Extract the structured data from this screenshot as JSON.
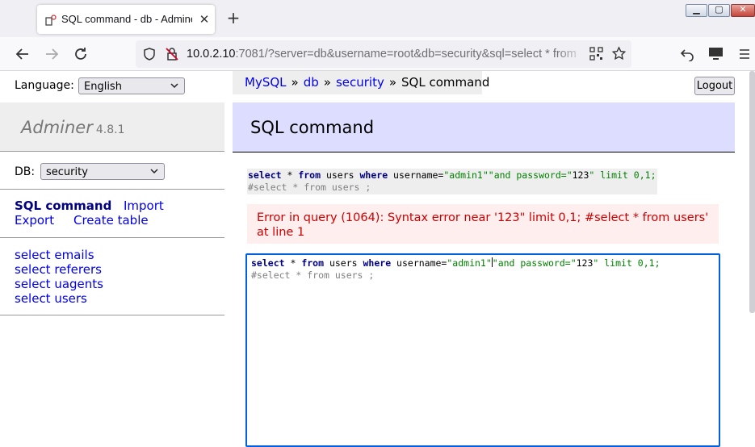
{
  "browser": {
    "tab_title": "SQL command - db - Adminer",
    "url_host": "10.0.2.10",
    "url_rest": ":7081/?server=db&username=root&db=security&sql=select * from"
  },
  "sidebar": {
    "language_label": "Language:",
    "language_value": "English",
    "logo": "Adminer",
    "version": "4.8.1",
    "db_label": "DB:",
    "db_value": "security",
    "links": {
      "sql_command": "SQL command",
      "import": "Import",
      "export": "Export",
      "create_table": "Create table"
    },
    "tables": [
      "select emails",
      "select referers",
      "select uagents",
      "select users"
    ]
  },
  "breadcrumb": {
    "items": [
      "MySQL",
      "db",
      "security"
    ],
    "separator": "»",
    "current": "SQL command"
  },
  "logout_label": "Logout",
  "title": "SQL command",
  "sql": {
    "line1": {
      "kw_select": "select",
      "star": " * ",
      "kw_from": "from",
      "table": " users ",
      "kw_where": "where",
      "cond": " username=",
      "str1": "\"admin1\"",
      "str2": "\"and password=\"",
      "str3": "123",
      "str4": "\" limit 0,1;"
    },
    "line2": "#select * from users ;"
  },
  "error_message": "Error in query (1064): Syntax error near '123\" limit 0,1; #select * from users' at line 1",
  "colors": {
    "link": "#0000ee",
    "title_bg": "#ddddff",
    "error_bg": "#ffeeee",
    "error_text": "#cc0000",
    "editor_border": "#0060df"
  }
}
